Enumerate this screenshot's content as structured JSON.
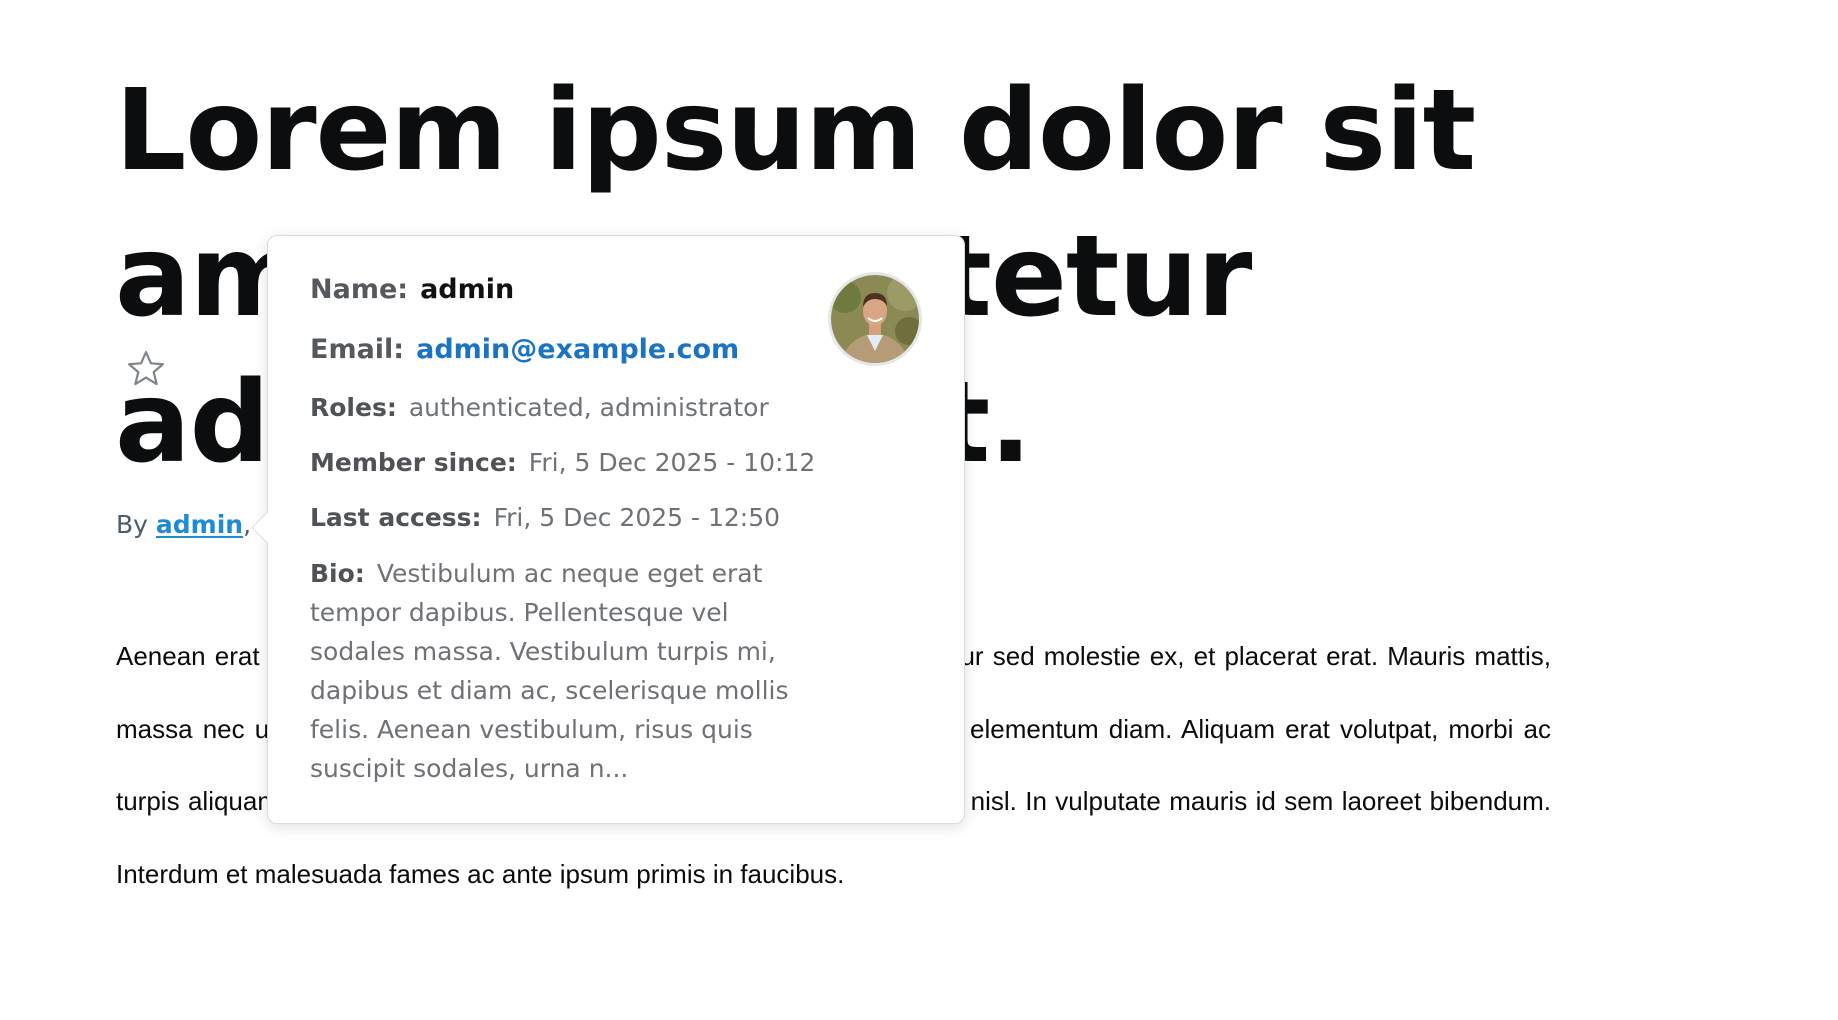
{
  "article": {
    "title": "Lorem ipsum dolor sit amet, consectetur adipiscing elit.",
    "byline_prefix": "By ",
    "author_link": "admin",
    "byline_suffix": ",",
    "body": "Aenean erat nulla, pharetra vel lacinia vel, porttitor vitae mauris. Curabitur sed molestie ex, et placerat erat. Mauris mattis, massa nec ultrices fringilla, purus tortor tincidunt. Suspendisse sit amet elementum diam. Aliquam erat volutpat, morbi ac turpis aliquam. Duis in lacus non justo varius tristique. Ut sit amet finibus nisl. In vulputate mauris id sem laoreet bibendum. Interdum et malesuada fames ac ante ipsum primis in faucibus."
  },
  "icons": {
    "favorite": "star-outline-icon"
  },
  "user_card": {
    "name_label": "Name:",
    "name_value": "admin",
    "email_label": "Email:",
    "email_value": "admin@example.com",
    "roles_label": "Roles:",
    "roles_value": "authenticated, administrator",
    "member_since_label": "Member since:",
    "member_since_value": "Fri, 5 Dec 2025 - 10:12",
    "last_access_label": "Last access:",
    "last_access_value": "Fri, 5 Dec 2025 - 12:50",
    "bio_label": "Bio:",
    "bio_value": "Vestibulum ac neque eget erat tempor dapibus. Pellentesque vel sodales massa. Vestibulum turpis mi, dapibus et diam ac, scelerisque mollis felis. Aenean vestibulum, risus quis suscipit sodales, urna n..."
  },
  "colors": {
    "link": "#1f8ad6",
    "card_link": "#1b74c2",
    "headline": "#0b0d0e",
    "muted_text": "#6e7276"
  }
}
